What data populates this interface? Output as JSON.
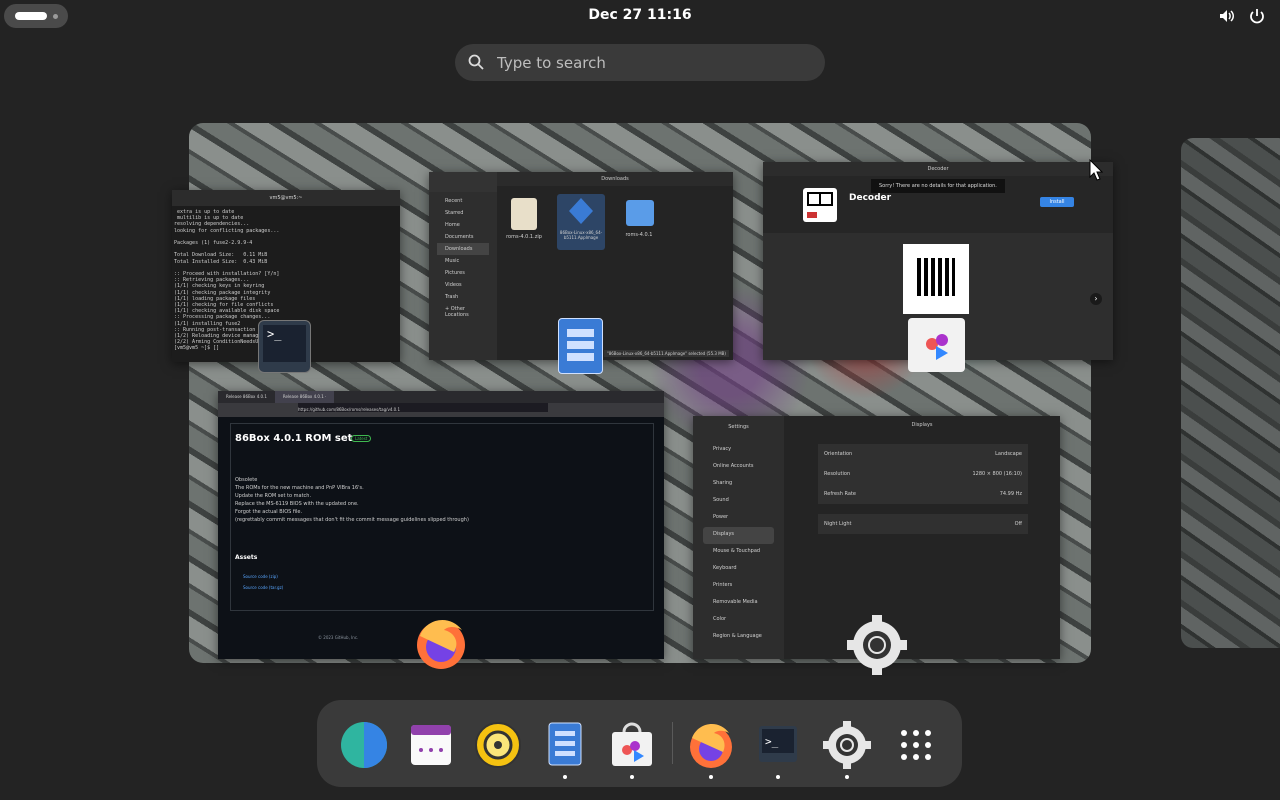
{
  "topbar": {
    "clock": "Dec 27  11:16"
  },
  "search": {
    "placeholder": "Type to search"
  },
  "windows": {
    "terminal": {
      "title": "vm5@vm5:~",
      "lines": [
        " extra is up to date",
        " multilib is up to date",
        "resolving dependencies...",
        "looking for conflicting packages...",
        "",
        "Packages (1) fuse2-2.9.9-4",
        "",
        "Total Download Size:   0.11 MiB",
        "Total Installed Size:  0.43 MiB",
        "",
        ":: Proceed with installation? [Y/n]",
        ":: Retrieving packages...",
        "(1/1) checking keys in keyring",
        "(1/1) checking package integrity",
        "(1/1) loading package files",
        "(1/1) checking for file conflicts",
        "(1/1) checking available disk space",
        ":: Processing package changes...",
        "(1/1) installing fuse2",
        ":: Running post-transaction hooks...",
        "(1/2) Reloading device manager...",
        "(2/2) Arming ConditionNeedsUpdate...",
        "[vm5@vm5 ~]$ []"
      ]
    },
    "files": {
      "title": "Downloads",
      "sidebar": [
        "Recent",
        "Starred",
        "Home",
        "Documents",
        "Downloads",
        "Music",
        "Pictures",
        "Videos",
        "Trash",
        "+ Other Locations"
      ],
      "items": [
        "roms-4.0.1.zip",
        "86Box-Linux-x86_64-b5111.AppImage",
        "roms-4.0.1"
      ],
      "status": "\"86Box-Linux-x86_64-b5111.AppImage\" selected (55.3 MB)"
    },
    "software": {
      "title": "Decoder",
      "toast": "Sorry! There are no details for that application.",
      "app_name": "Decoder",
      "install_label": "Install"
    },
    "browser": {
      "tabs": [
        "Release 86Box 4.0.1",
        "Release 86Box 4.0.1 ·"
      ],
      "url": "https://github.com/86Box/roms/releases/tag/v4.0.1",
      "heading": "86Box 4.0.1 ROM set",
      "badge": "Latest",
      "body": [
        "Obsolete",
        "The ROMs for the new machine and PnP VIBra 16's.",
        "Update the ROM set to match.",
        "Replace the MS-6119 BIOS with the updated one.",
        "Forgot the actual BIOS file.",
        "",
        "(regrettably commit messages that don't fit the commit message guidelines slipped through)"
      ],
      "assets_label": "Assets",
      "assets": [
        "Source code (zip)",
        "Source code (tar.gz)"
      ],
      "footer": "© 2023 GitHub, Inc."
    },
    "settings": {
      "title": "Displays",
      "sidebar_title": "Settings",
      "sidebar": [
        "Privacy",
        "Online Accounts",
        "Sharing",
        "Sound",
        "Power",
        "Displays",
        "Mouse & Touchpad",
        "Keyboard",
        "Printers",
        "Removable Media",
        "Color",
        "Region & Language"
      ],
      "rows": [
        {
          "label": "Orientation",
          "value": "Landscape"
        },
        {
          "label": "Resolution",
          "value": "1280 × 800 (16:10)"
        },
        {
          "label": "Refresh Rate",
          "value": "74.99 Hz"
        },
        {
          "label": "Night Light",
          "value": "Off"
        }
      ]
    }
  },
  "dock": {
    "items": [
      {
        "name": "web-browser-icon",
        "running": false
      },
      {
        "name": "calendar-icon",
        "running": false
      },
      {
        "name": "rhythmbox-icon",
        "running": false
      },
      {
        "name": "files-icon",
        "running": true
      },
      {
        "name": "software-icon",
        "running": true
      },
      {
        "name": "firefox-icon",
        "running": true
      },
      {
        "name": "terminal-icon",
        "running": true
      },
      {
        "name": "settings-icon",
        "running": true
      },
      {
        "name": "app-grid-icon",
        "running": false
      }
    ]
  }
}
